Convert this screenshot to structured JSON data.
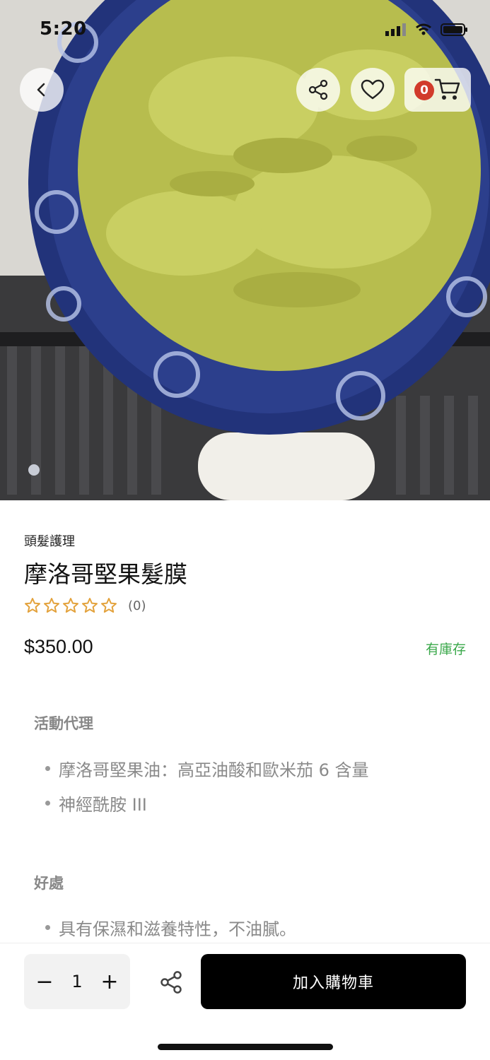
{
  "status_bar": {
    "time": "5:20"
  },
  "header": {
    "cart_count": "0"
  },
  "product": {
    "category": "頭髮護理",
    "title": "摩洛哥堅果髮膜",
    "rating_count": "(0)",
    "rating_stars": 0,
    "price": "$350.00",
    "stock": "有庫存"
  },
  "description": {
    "section1_heading": "活動代理",
    "section1_items": [
      "摩洛哥堅果油：高亞油酸和歐米茄 6 含量",
      "神經酰胺 III"
    ],
    "section2_heading": "好處",
    "section2_items": [
      "具有保濕和滋養特性，不油膩。"
    ]
  },
  "bottom_bar": {
    "quantity": "1",
    "minus": "−",
    "plus": "+",
    "add_to_cart": "加入購物車"
  },
  "colors": {
    "stock": "#3aa84a",
    "badge": "#d13b2b",
    "star": "#e3a23c"
  }
}
